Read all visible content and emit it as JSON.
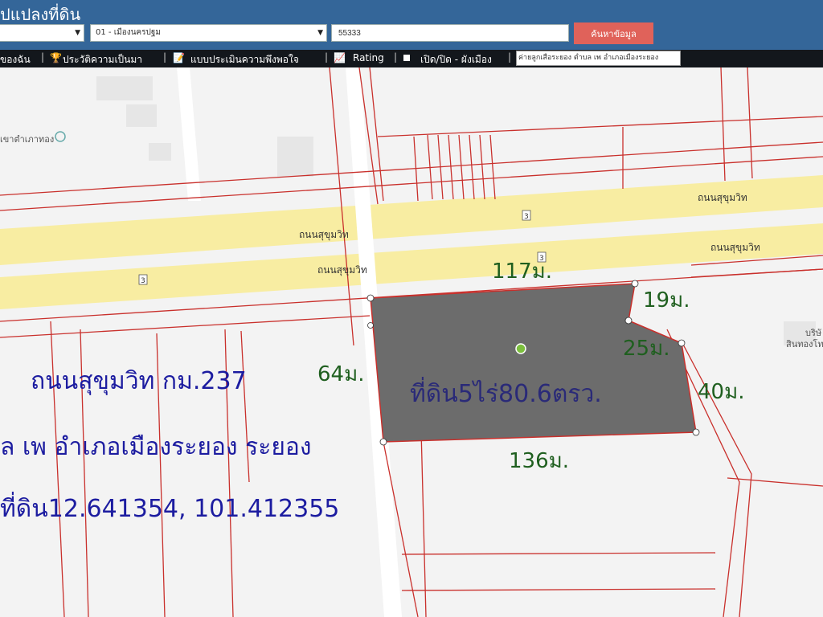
{
  "header": {
    "title": "ปแปลงที่ดิน"
  },
  "search": {
    "district_value": "01 - เมืองนครปฐม",
    "parcel_value": "55333",
    "search_label": "ค้นหาข้อมูล"
  },
  "toolbar": {
    "items": [
      {
        "label": "ของฉัน"
      },
      {
        "label": "ประวัติความเป็นมา"
      },
      {
        "label": "แบบประเมินความพึงพอใจ"
      },
      {
        "label": "Rating"
      },
      {
        "label": "เปิด/ปิด - ผังเมือง"
      }
    ],
    "search_value": "ค่ายลูกเสือระยอง ตำบล เพ อำเภอเมืองระยอง"
  },
  "map": {
    "place_label": "เขาตำเภาทอง",
    "road_labels": [
      "ถนนสุขุมวิท",
      "ถนนสุขุมวิท",
      "ถนนสุขุมวิท",
      "ถนนสุขุมวิท"
    ],
    "route_number": "3",
    "building_label_top": "บริษั",
    "building_label_bottom": "สินทองโท",
    "parcel_label": "ที่ดิน5ไร่80.6ตรว.",
    "dimensions": {
      "top": "117ม.",
      "right_top": "19ม.",
      "right_inner": "25ม.",
      "right": "40ม.",
      "left": "64ม.",
      "bottom": "136ม."
    },
    "annotations": [
      "ถนนสุขุมวิท กม.237",
      "ล เพ อำเภอเมืองระยอง ระยอง",
      "ที่ดิน12.641354, 101.412355"
    ],
    "colors": {
      "road": "#f8eda2",
      "parcel": "#6c6c6c",
      "boundary": "#c9302c",
      "annotation": "#1c1ca0",
      "dimension": "#1f5f1f"
    }
  }
}
